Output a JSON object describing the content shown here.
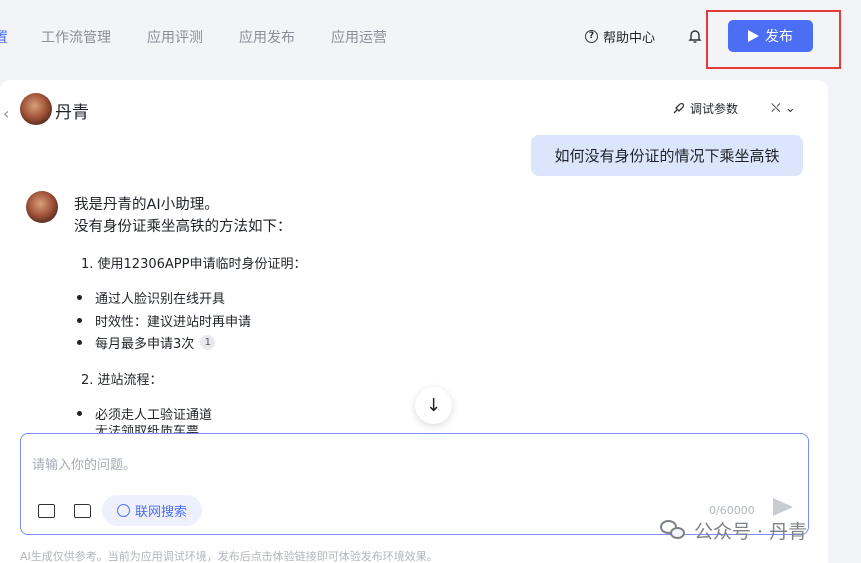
{
  "nav": {
    "tabs": [
      {
        "label": "置"
      },
      {
        "label": "工作流管理"
      },
      {
        "label": "应用评测"
      },
      {
        "label": "应用发布"
      },
      {
        "label": "应用运营"
      }
    ],
    "help_label": "帮助中心",
    "publish_label": "发布"
  },
  "chat": {
    "bot_name": "丹青",
    "debug_label": "调试参数",
    "user_message": "如何没有身份证的情况下乘坐高铁",
    "reply": {
      "intro": "我是丹青的AI小助理。",
      "heading": "没有身份证乘坐高铁的方法如下：",
      "step1": "1. 使用12306APP申请临时身份证明：",
      "step1_items": [
        "通过人脸识别在线开具",
        "时效性：建议进站时再申请",
        "每月最多申请3次"
      ],
      "citation": "1",
      "step2": "2. 进站流程：",
      "step2_items": [
        "必须走人工验证通道",
        "无法领取纸质车票"
      ]
    }
  },
  "composer": {
    "placeholder": "请输入你的问题。",
    "web_search_label": "联网搜索",
    "counter": "0/60000"
  },
  "footer_note": "AI生成仅供参考。当前为应用调试环境，发布后点击体验链接即可体验发布环境效果。",
  "watermark": "公众号 · 丹青",
  "colors": {
    "accent": "#4c6ef5",
    "highlight_border": "#e33b3b",
    "user_bubble": "#dbe5fb"
  }
}
